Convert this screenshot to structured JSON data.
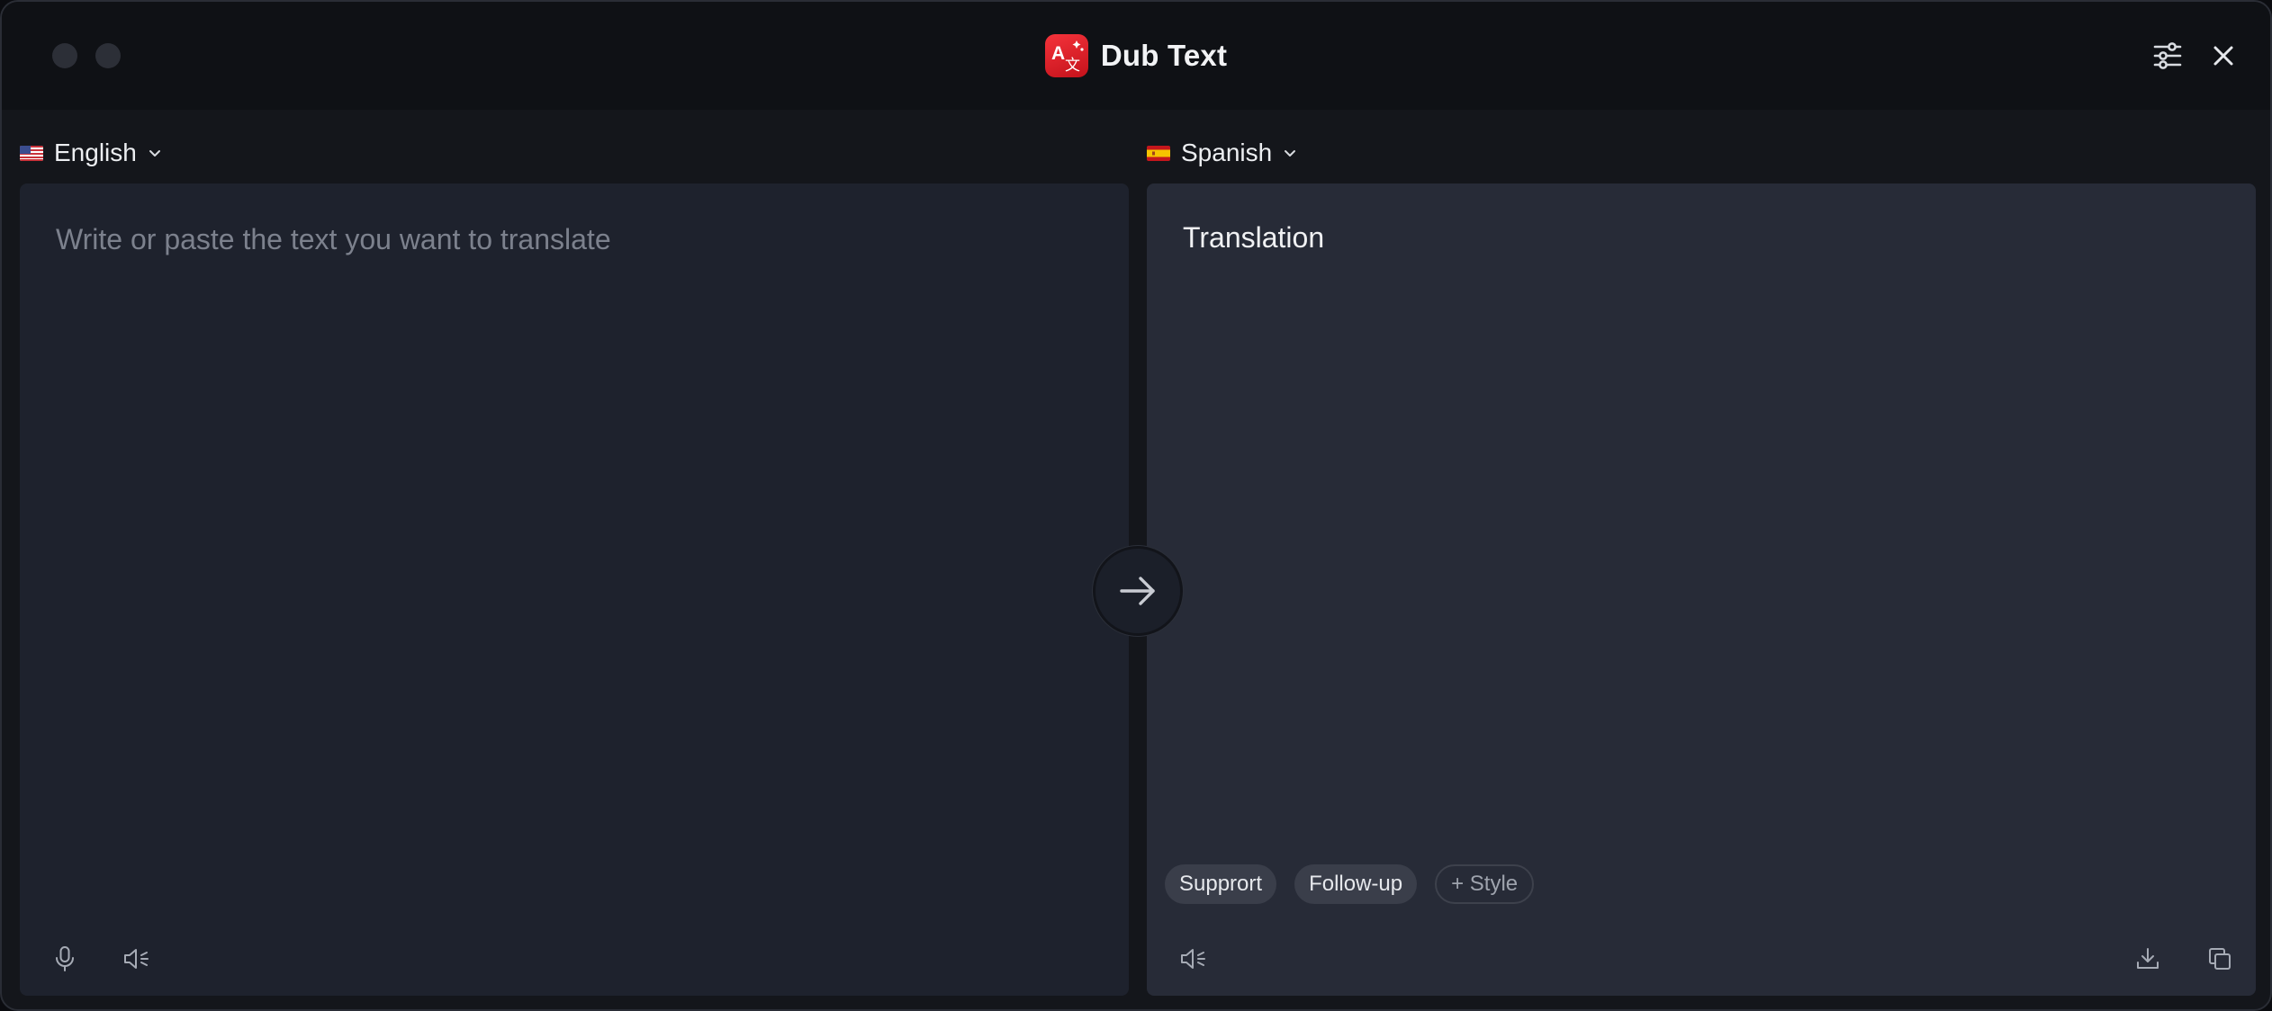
{
  "window": {
    "title": "Dub Text",
    "app_icon": "translate-icon",
    "accent_color": "#e0202a"
  },
  "titlebar": {
    "settings_icon": "sliders-icon",
    "close_icon": "close-icon"
  },
  "source": {
    "language": "English",
    "flag": "us-flag-icon",
    "input_value": "",
    "placeholder": "Write or paste the text you want to translate",
    "mic_icon": "microphone-icon",
    "speaker_icon": "speaker-icon"
  },
  "target": {
    "language": "Spanish",
    "flag": "spain-flag-icon",
    "output_text": "Translation",
    "chips": [
      {
        "label": "Supprort"
      },
      {
        "label": "Follow-up"
      }
    ],
    "add_style_label": "+ Style",
    "speaker_icon": "speaker-icon",
    "download_icon": "download-icon",
    "copy_icon": "copy-icon"
  },
  "translate_button_icon": "arrow-right-icon"
}
